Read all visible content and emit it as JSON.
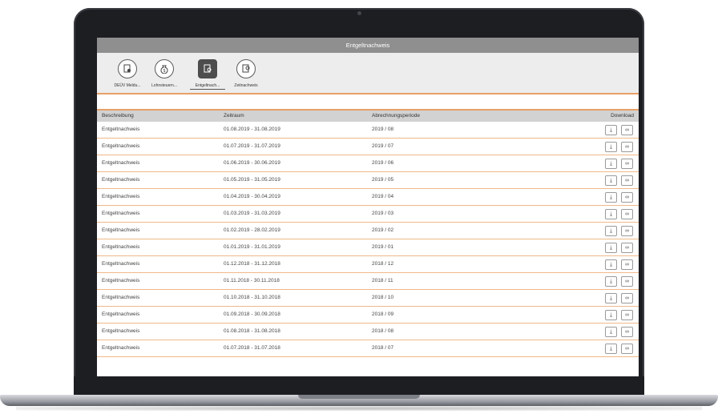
{
  "app": {
    "title": "Entgeltnachweis"
  },
  "toolbar": {
    "items": [
      {
        "label": "DEÜV Meldu...",
        "icon": "document-person-icon",
        "active": false
      },
      {
        "label": "Lohnsteuern...",
        "icon": "money-bag-icon",
        "active": false
      },
      {
        "label": "Entgeltnach...",
        "icon": "document-search-icon",
        "active": true
      },
      {
        "label": "Zeitnachweis",
        "icon": "document-clock-icon",
        "active": false
      }
    ]
  },
  "table": {
    "headers": [
      "Beschreibung",
      "Zeitraum",
      "Abrechnungsperiode",
      "Download"
    ],
    "rows": [
      {
        "desc": "Entgeltnachweis",
        "range": "01.08.2019 - 31.08.2019",
        "period": "2019 / 08"
      },
      {
        "desc": "Entgeltnachweis",
        "range": "01.07.2019 - 31.07.2019",
        "period": "2019 / 07"
      },
      {
        "desc": "Entgeltnachweis",
        "range": "01.06.2019 - 30.06.2019",
        "period": "2019 / 06"
      },
      {
        "desc": "Entgeltnachweis",
        "range": "01.05.2019 - 31.05.2019",
        "period": "2019 / 05"
      },
      {
        "desc": "Entgeltnachweis",
        "range": "01.04.2019 - 30.04.2019",
        "period": "2019 / 04"
      },
      {
        "desc": "Entgeltnachweis",
        "range": "01.03.2019 - 31.03.2019",
        "period": "2019 / 03"
      },
      {
        "desc": "Entgeltnachweis",
        "range": "01.02.2019 - 28.02.2019",
        "period": "2019 / 02"
      },
      {
        "desc": "Entgeltnachweis",
        "range": "01.01.2019 - 31.01.2019",
        "period": "2019 / 01"
      },
      {
        "desc": "Entgeltnachweis",
        "range": "01.12.2018 - 31.12.2018",
        "period": "2018 / 12"
      },
      {
        "desc": "Entgeltnachweis",
        "range": "01.11.2018 - 30.11.2018",
        "period": "2018 / 11"
      },
      {
        "desc": "Entgeltnachweis",
        "range": "01.10.2018 - 31.10.2018",
        "period": "2018 / 10"
      },
      {
        "desc": "Entgeltnachweis",
        "range": "01.09.2018 - 30.09.2018",
        "period": "2018 / 09"
      },
      {
        "desc": "Entgeltnachweis",
        "range": "01.08.2018 - 31.08.2018",
        "period": "2018 / 08"
      },
      {
        "desc": "Entgeltnachweis",
        "range": "01.07.2018 - 31.07.2018",
        "period": "2018 / 07"
      }
    ]
  },
  "colors": {
    "accent": "#e8a067",
    "header_bg": "#d2d2d2",
    "titlebar_bg": "#8f8f8f"
  }
}
